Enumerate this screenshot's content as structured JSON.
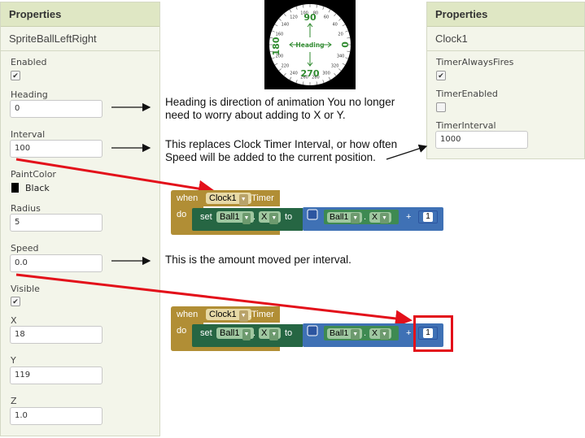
{
  "left_panel": {
    "header": "Properties",
    "component": "SpriteBallLeftRight",
    "props": {
      "enabled_label": "Enabled",
      "enabled_value": "✔",
      "heading_label": "Heading",
      "heading_value": "0",
      "interval_label": "Interval",
      "interval_value": "100",
      "paintcolor_label": "PaintColor",
      "paintcolor_value": "Black",
      "radius_label": "Radius",
      "radius_value": "5",
      "speed_label": "Speed",
      "speed_value": "0.0",
      "visible_label": "Visible",
      "visible_value": "✔",
      "x_label": "X",
      "x_value": "18",
      "y_label": "Y",
      "y_value": "119",
      "z_label": "Z",
      "z_value": "1.0"
    }
  },
  "right_panel": {
    "header": "Properties",
    "component": "Clock1",
    "props": {
      "timeralwaysfires_label": "TimerAlwaysFires",
      "timeralwaysfires_value": "✔",
      "timerenabled_label": "TimerEnabled",
      "timerenabled_value": "",
      "timerinterval_label": "TimerInterval",
      "timerinterval_value": "1000"
    }
  },
  "compass": {
    "top": "90",
    "bottom": "270",
    "left": "180",
    "right": "0",
    "center": "Heading",
    "ticks": [
      "120",
      "100",
      "80",
      "60",
      "40",
      "140",
      "160",
      "200",
      "220",
      "240",
      "260",
      "280",
      "300",
      "320",
      "340",
      "20"
    ]
  },
  "annotations": {
    "heading_note": [
      "Heading is direction of animation You no longer",
      "need to worry about adding to X or Y."
    ],
    "interval_note": [
      "This replaces Clock Timer Interval, or how often",
      "Speed will be added to the current position."
    ],
    "speed_note": "This is the amount moved per interval."
  },
  "blocks": {
    "when": "when",
    "clock": "Clock1",
    "timer": ".Timer",
    "do": "do",
    "set": "set",
    "ball": "Ball1",
    "dot": ".",
    "prop": "X",
    "to": "to",
    "plus": "+",
    "num": "1"
  },
  "colors": {
    "panel_header": "#dfe7c4",
    "event_block": "#b18e35",
    "setter_block": "#266643",
    "math_block": "#3f71b5",
    "arrow_red": "#e3101a"
  }
}
